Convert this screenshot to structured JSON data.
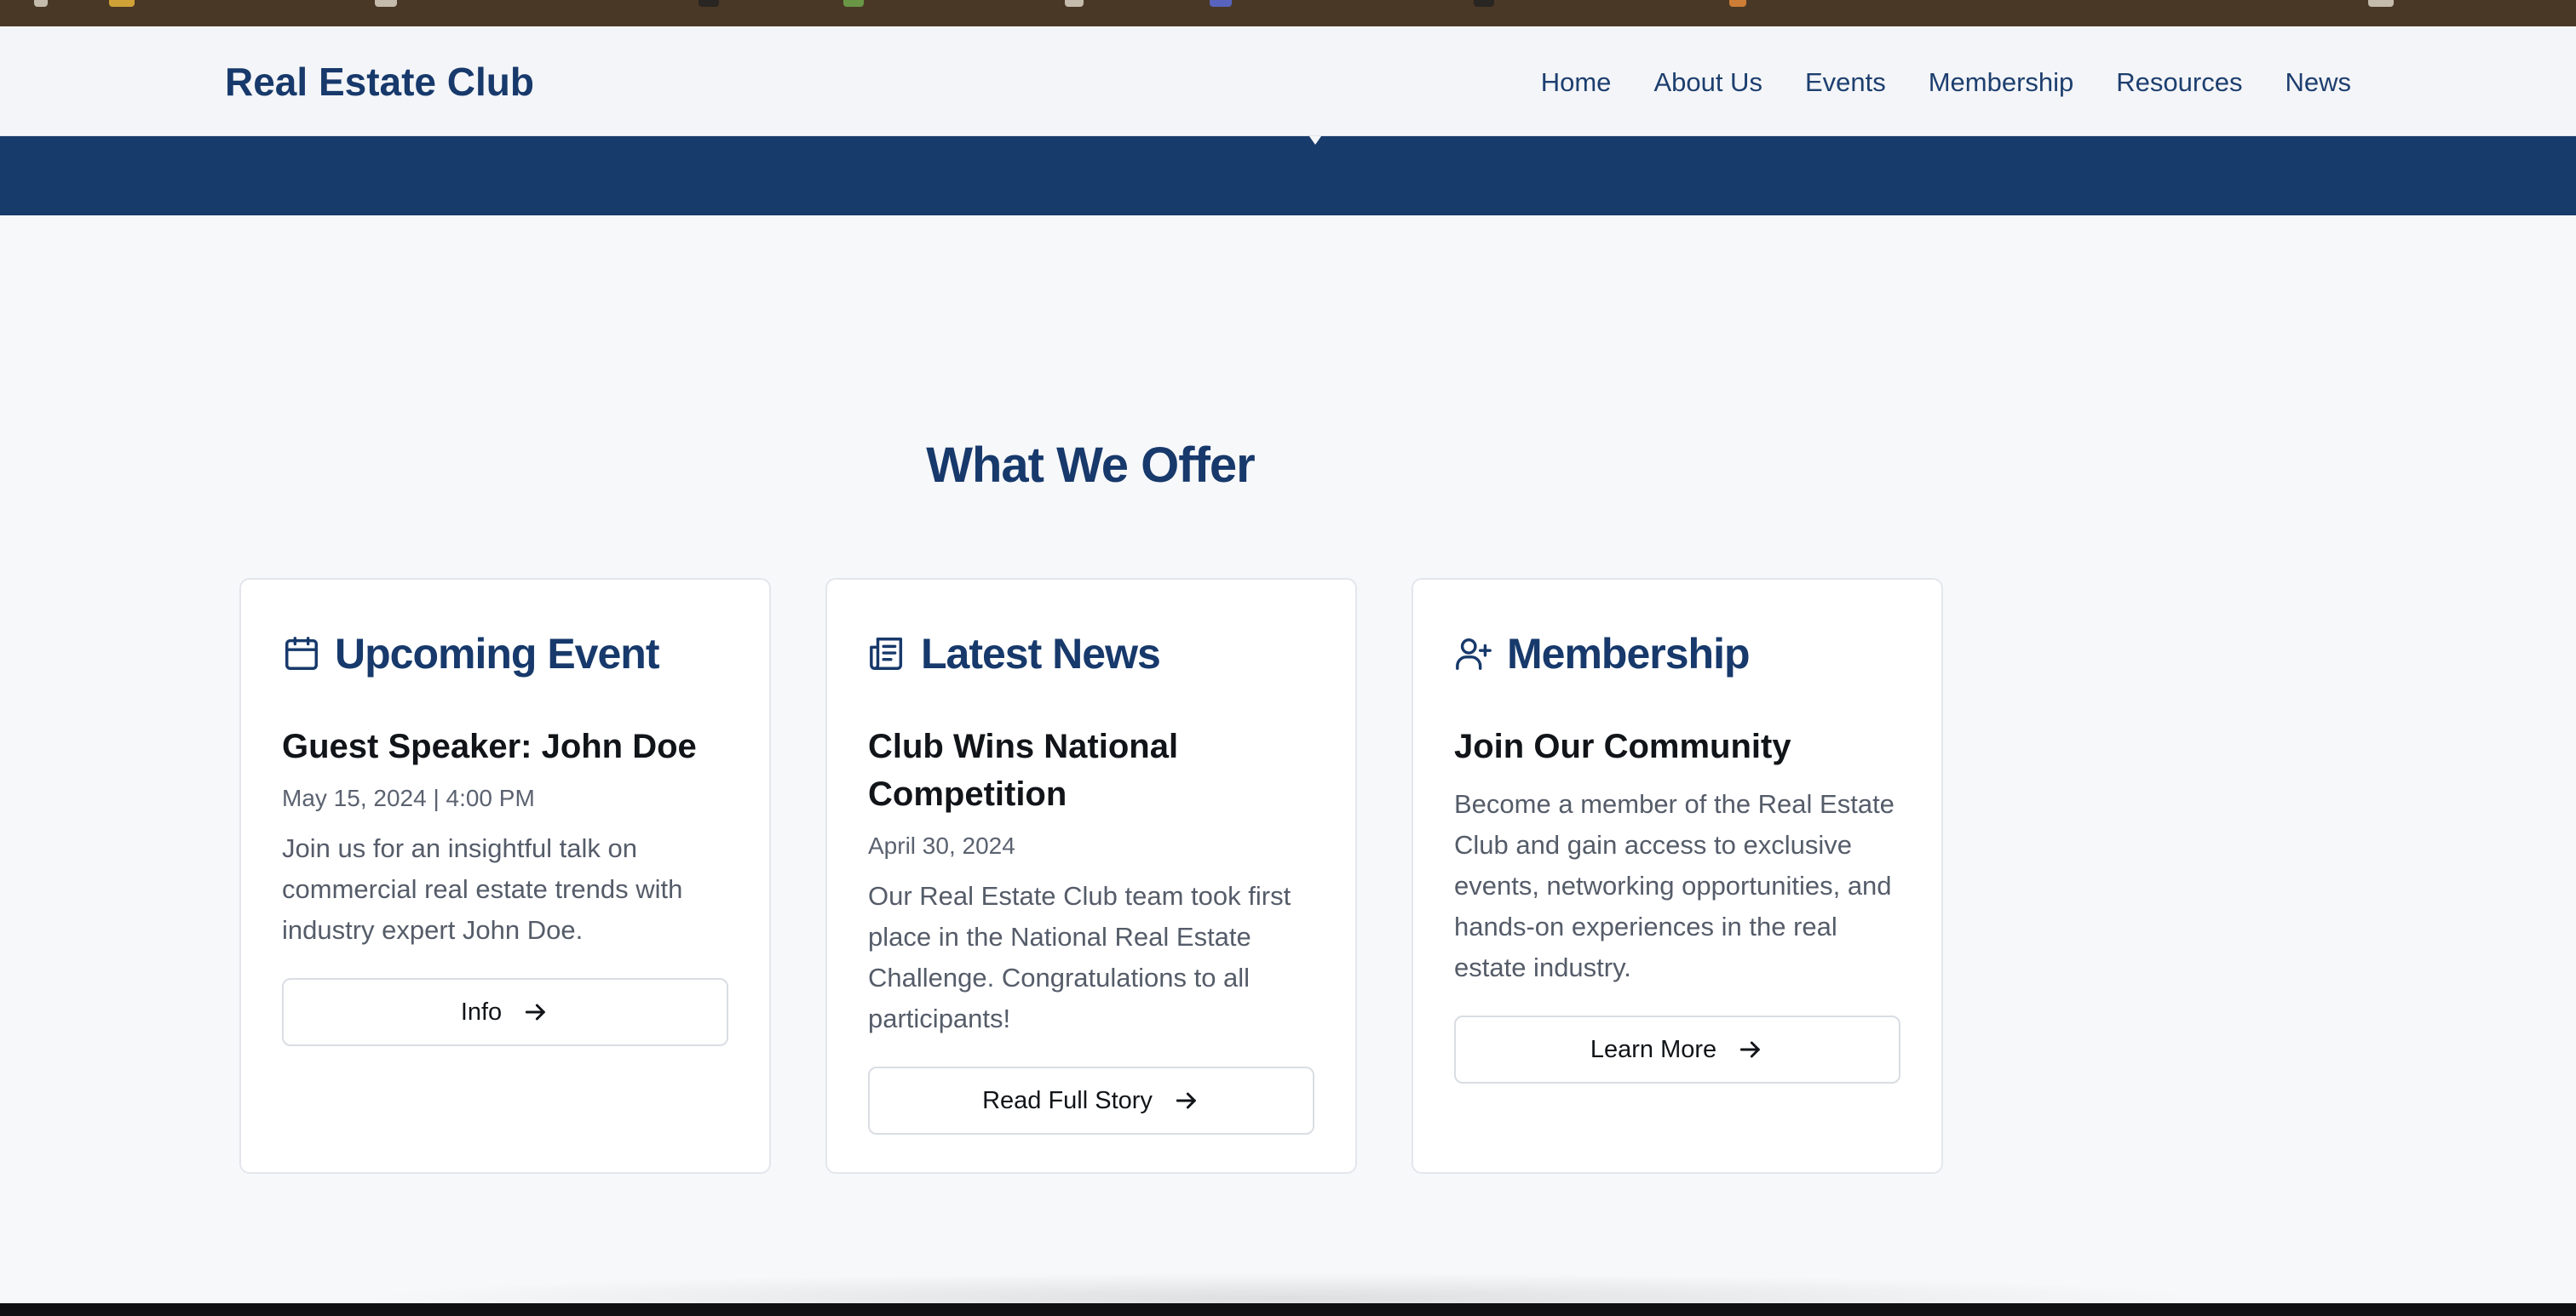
{
  "brand": {
    "name": "Real Estate Club",
    "color": "#17396b"
  },
  "nav": {
    "items": [
      {
        "label": "Home"
      },
      {
        "label": "About Us"
      },
      {
        "label": "Events"
      },
      {
        "label": "Membership"
      },
      {
        "label": "Resources"
      },
      {
        "label": "News"
      }
    ]
  },
  "colors": {
    "hero": "#173b6b",
    "page_bg": "#f7f8fa",
    "heading": "#17396b",
    "body_text": "#555c69"
  },
  "section": {
    "title": "What We Offer"
  },
  "cards": [
    {
      "icon": "calendar-icon",
      "heading": "Upcoming Event",
      "title": "Guest Speaker: John Doe",
      "date": "May 15, 2024 | 4:00 PM",
      "body": "Join us for an insightful talk on commercial real estate trends with industry expert John Doe.",
      "button": "Info"
    },
    {
      "icon": "newspaper-icon",
      "heading": "Latest News",
      "title": "Club Wins National Competition",
      "date": "April 30, 2024",
      "body": "Our Real Estate Club team took first place in the National Real Estate Challenge. Congratulations to all participants!",
      "button": "Read Full Story"
    },
    {
      "icon": "user-plus-icon",
      "heading": "Membership",
      "title": "Join Our Community",
      "date": "",
      "body": "Become a member of the Real Estate Club and gain access to exclusive events, networking opportunities, and hands-on experiences in the real estate industry.",
      "button": "Learn More"
    }
  ]
}
